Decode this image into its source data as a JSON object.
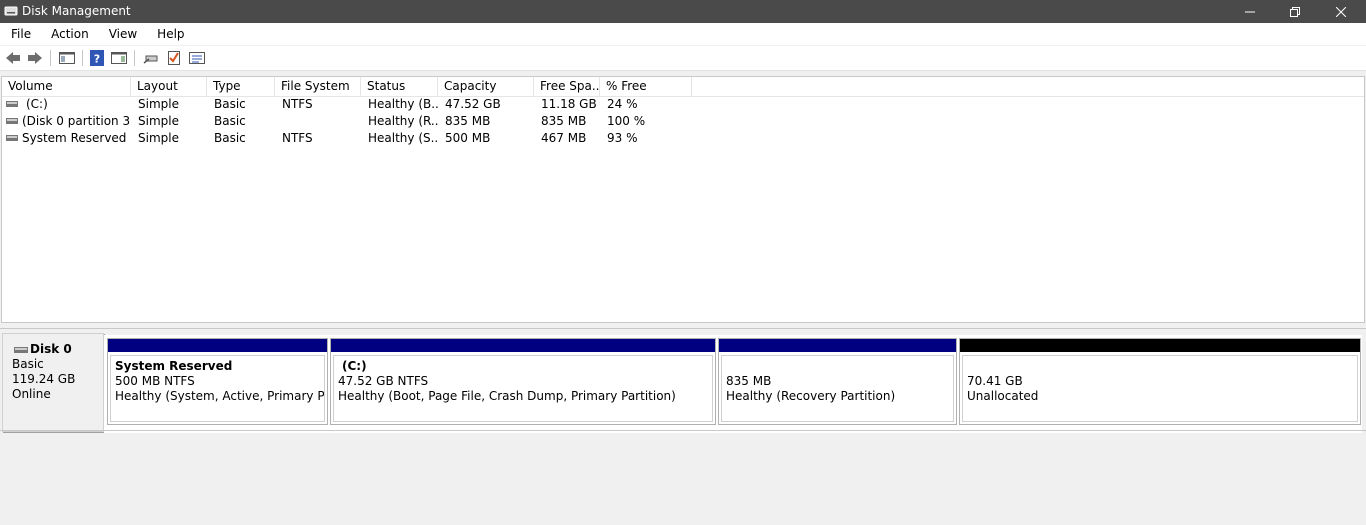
{
  "window": {
    "title": "Disk Management",
    "icon": "disk-management-icon",
    "controls": [
      "minimize-icon",
      "restore-icon",
      "close-icon"
    ]
  },
  "menu": {
    "items": [
      {
        "label": "File"
      },
      {
        "label": "Action"
      },
      {
        "label": "View"
      },
      {
        "label": "Help"
      }
    ]
  },
  "toolbar": {
    "buttons": [
      "back-arrow-icon",
      "forward-arrow-icon",
      "show-hide-console-tree-icon",
      "help-icon",
      "properties-panel-icon",
      "connect-drive-icon",
      "check-task-icon",
      "list-view-icon"
    ]
  },
  "volumes": {
    "headers": [
      "Volume",
      "Layout",
      "Type",
      "File System",
      "Status",
      "Capacity",
      "Free Spa...",
      "% Free"
    ],
    "rows": [
      {
        "volume": "(C:)",
        "layout": "Simple",
        "type": "Basic",
        "fs": "NTFS",
        "status": "Healthy (B...",
        "capacity": "47.52 GB",
        "free": "11.18 GB",
        "pct": "24 %"
      },
      {
        "volume": "(Disk 0 partition 3)",
        "layout": "Simple",
        "type": "Basic",
        "fs": "",
        "status": "Healthy (R...",
        "capacity": "835 MB",
        "free": "835 MB",
        "pct": "100 %"
      },
      {
        "volume": "System Reserved",
        "layout": "Simple",
        "type": "Basic",
        "fs": "NTFS",
        "status": "Healthy (S...",
        "capacity": "500 MB",
        "free": "467 MB",
        "pct": "93 %"
      }
    ]
  },
  "disk": {
    "name": "Disk 0",
    "type": "Basic",
    "size": "119.24 GB",
    "state": "Online",
    "partitions": [
      {
        "name": "System Reserved",
        "line1": "500 MB NTFS",
        "line2": "Healthy (System, Active, Primary Partiti",
        "bar_color": "#000080"
      },
      {
        "name": "(C:)",
        "line1": "47.52 GB NTFS",
        "line2": "Healthy (Boot, Page File, Crash Dump, Primary Partition)",
        "bar_color": "#000080"
      },
      {
        "name": "",
        "line1": "835 MB",
        "line2": "Healthy (Recovery Partition)",
        "bar_color": "#000080"
      },
      {
        "name": "",
        "line1": "70.41 GB",
        "line2": "Unallocated",
        "bar_color": "#000000"
      }
    ]
  }
}
